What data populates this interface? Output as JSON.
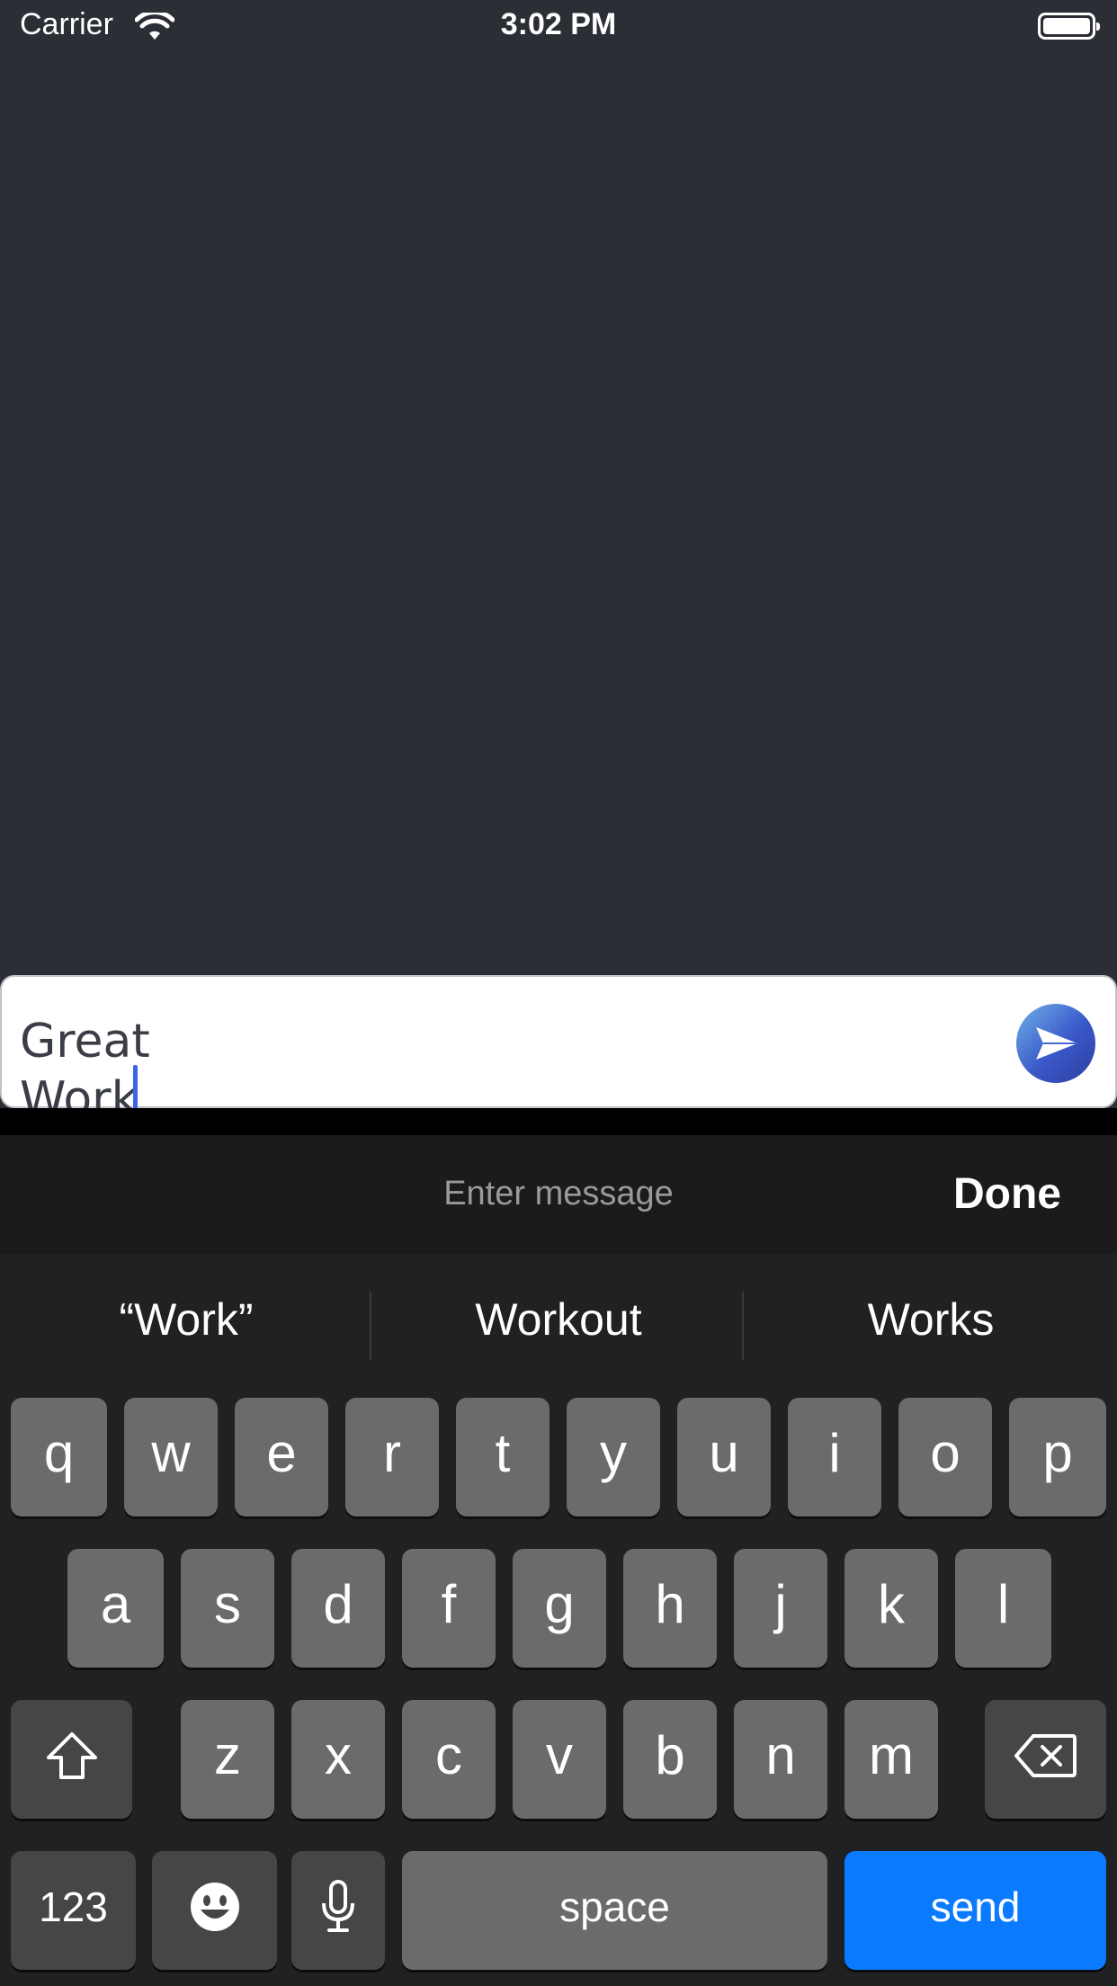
{
  "status_bar": {
    "carrier": "Carrier",
    "time": "3:02 PM"
  },
  "composer": {
    "text": "Great Work",
    "send_icon": "paper-plane-icon"
  },
  "keyboard": {
    "accessory": {
      "placeholder": "Enter message",
      "done_label": "Done"
    },
    "suggestions": [
      "“Work”",
      "Workout",
      "Works"
    ],
    "row1": [
      "q",
      "w",
      "e",
      "r",
      "t",
      "y",
      "u",
      "i",
      "o",
      "p"
    ],
    "row2": [
      "a",
      "s",
      "d",
      "f",
      "g",
      "h",
      "j",
      "k",
      "l"
    ],
    "row3": [
      "z",
      "x",
      "c",
      "v",
      "b",
      "n",
      "m"
    ],
    "numbers_label": "123",
    "space_label": "space",
    "send_label": "send",
    "send_color": "#0a7aff"
  },
  "colors": {
    "background": "#2b2e35",
    "caret": "#3a63e8"
  }
}
